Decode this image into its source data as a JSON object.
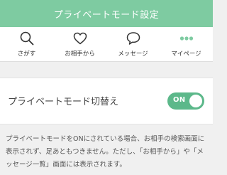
{
  "header": {
    "title": "プライベートモード設定"
  },
  "tabs": [
    {
      "label": "さがす",
      "icon": "search-icon"
    },
    {
      "label": "お相手から",
      "icon": "heart-icon"
    },
    {
      "label": "メッセージ",
      "icon": "speech-bubble-icon"
    },
    {
      "label": "マイページ",
      "icon": "more-dots-icon"
    }
  ],
  "setting": {
    "label": "プライベートモード切替え",
    "toggle_text": "ON",
    "toggle_state": true
  },
  "description": "プライベートモードをONにされている場合、お相手の検索画面に表示されず、足あともつきません。ただし、「お相手から」や「メッセージ一覧」画面には表示されます。",
  "colors": {
    "header_bg": "#7ecba1",
    "toggle_on": "#5cb88a",
    "icon_stroke": "#333333",
    "active_icon": "#7ecba1"
  }
}
